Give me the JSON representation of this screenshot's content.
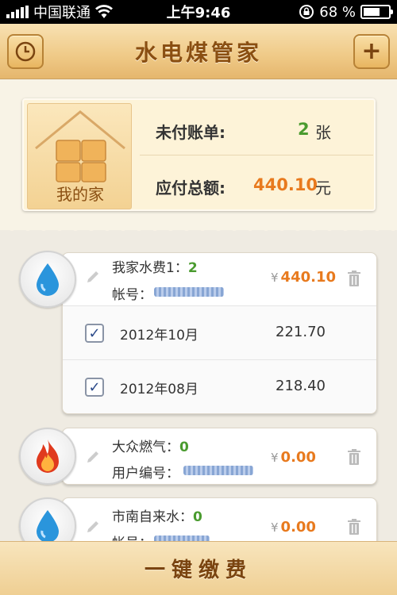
{
  "status_bar": {
    "carrier": "中国联通",
    "time": "上午9:46",
    "battery": "68 %",
    "battery_level": 0.68
  },
  "nav": {
    "title": "水电煤管家",
    "left_icon": "clock-icon",
    "right_label": "+"
  },
  "summary": {
    "home_label": "我的家",
    "unpaid_label": "未付账单:",
    "unpaid_count": "2",
    "unpaid_unit": "张",
    "total_label": "应付总额:",
    "total_amount": "440.10",
    "total_unit": "元"
  },
  "bills": [
    {
      "name": "我家水费1：",
      "count": "2",
      "account_label": "帐号：",
      "currency": "¥",
      "amount": "440.10",
      "icon": "water-drop-icon",
      "items": [
        {
          "date": "2012年10月",
          "amount": "221.70",
          "checked": true
        },
        {
          "date": "2012年08月",
          "amount": "218.40",
          "checked": true
        }
      ]
    },
    {
      "name": "大众燃气：",
      "count": "0",
      "account_label": "用户编号：",
      "currency": "¥",
      "amount": "0.00",
      "icon": "flame-icon"
    },
    {
      "name": "市南自来水：",
      "count": "0",
      "account_label": "帐号：",
      "currency": "¥",
      "amount": "0.00",
      "icon": "water-drop-icon"
    }
  ],
  "bottom": {
    "pay_label": "一键缴费"
  },
  "colors": {
    "accent_orange": "#e87a1e",
    "count_green": "#4a9b2f",
    "title_brown": "#8a4f12"
  }
}
